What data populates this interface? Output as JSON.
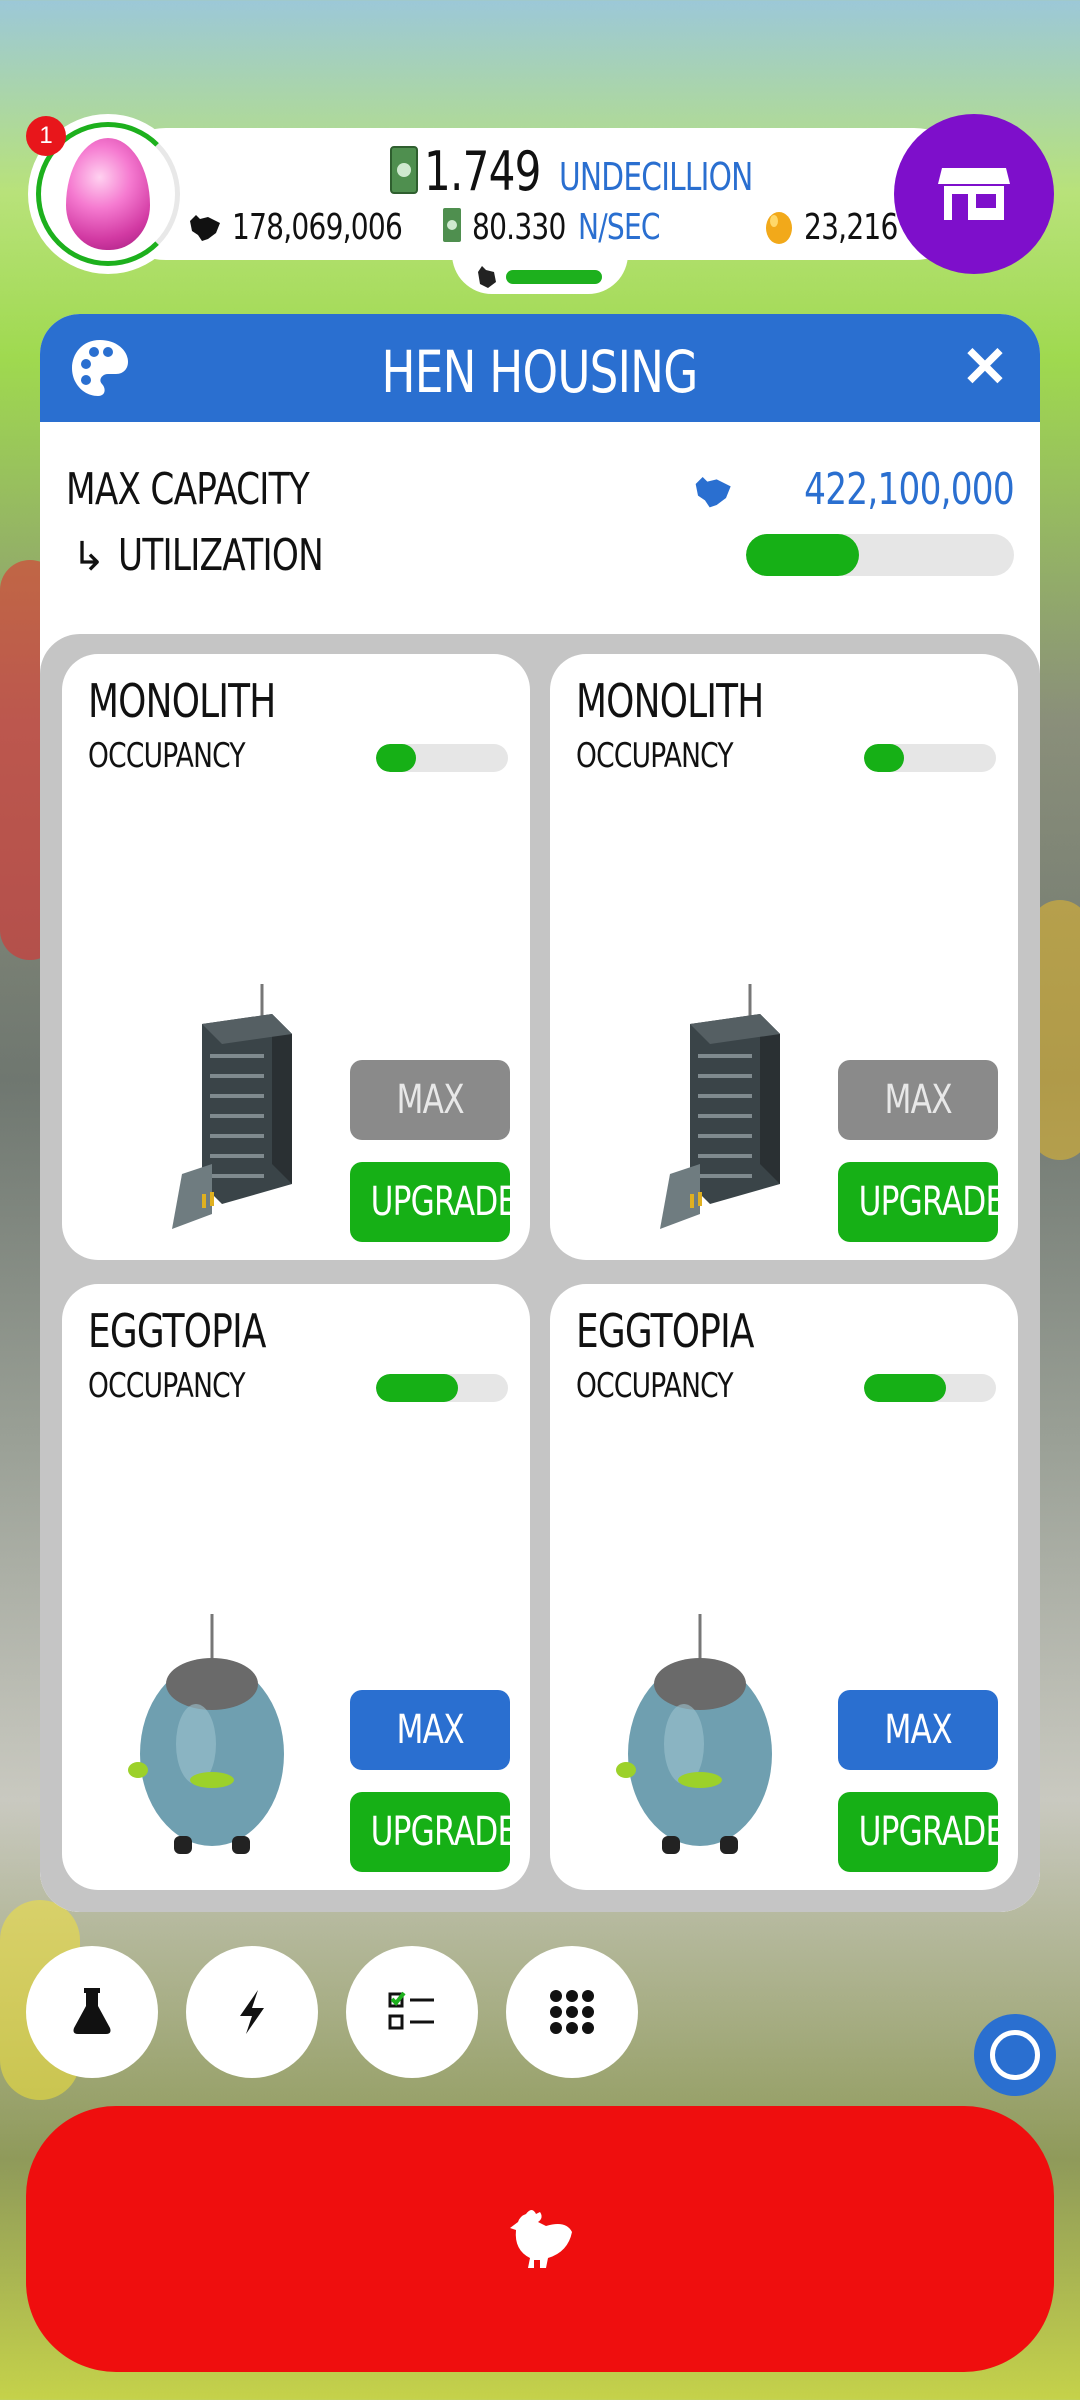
{
  "hud": {
    "notification_count": "1",
    "money_value": "1.749",
    "money_unit": "UNDECILLION",
    "chickens": "178,069,006",
    "rate_value": "80.330",
    "rate_unit": "N/SEC",
    "golden_eggs": "23,216",
    "chicken_progress": 0.9
  },
  "panel": {
    "title": "HEN HOUSING",
    "max_capacity_label": "MAX CAPACITY",
    "max_capacity_value": "422,100,000",
    "utilization_label": "UTILIZATION",
    "utilization_arrow": "↳",
    "utilization_fraction": 0.42
  },
  "houses": [
    {
      "name": "MONOLITH",
      "occupancy_label": "OCCUPANCY",
      "occupancy": 0.3,
      "max_label": "MAX",
      "max_state": "disabled",
      "upgrade_label": "UPGRADE"
    },
    {
      "name": "MONOLITH",
      "occupancy_label": "OCCUPANCY",
      "occupancy": 0.3,
      "max_label": "MAX",
      "max_state": "disabled",
      "upgrade_label": "UPGRADE"
    },
    {
      "name": "EGGTOPIA",
      "occupancy_label": "OCCUPANCY",
      "occupancy": 0.62,
      "max_label": "MAX",
      "max_state": "enabled",
      "upgrade_label": "UPGRADE"
    },
    {
      "name": "EGGTOPIA",
      "occupancy_label": "OCCUPANCY",
      "occupancy": 0.62,
      "max_label": "MAX",
      "max_state": "enabled",
      "upgrade_label": "UPGRADE"
    }
  ],
  "icons": {
    "palette": "palette-icon",
    "close": "close-icon",
    "shop": "shop-icon",
    "bottom": [
      "flask-icon",
      "lightning-icon",
      "checklist-icon",
      "grid-icon"
    ],
    "hatch": "chicken-icon"
  },
  "colors": {
    "accent_blue": "#2a6fd0",
    "green": "#16b016",
    "purple": "#7e0fcb",
    "red": "#ef0e0e",
    "gray_disabled": "#8a8a8a"
  }
}
